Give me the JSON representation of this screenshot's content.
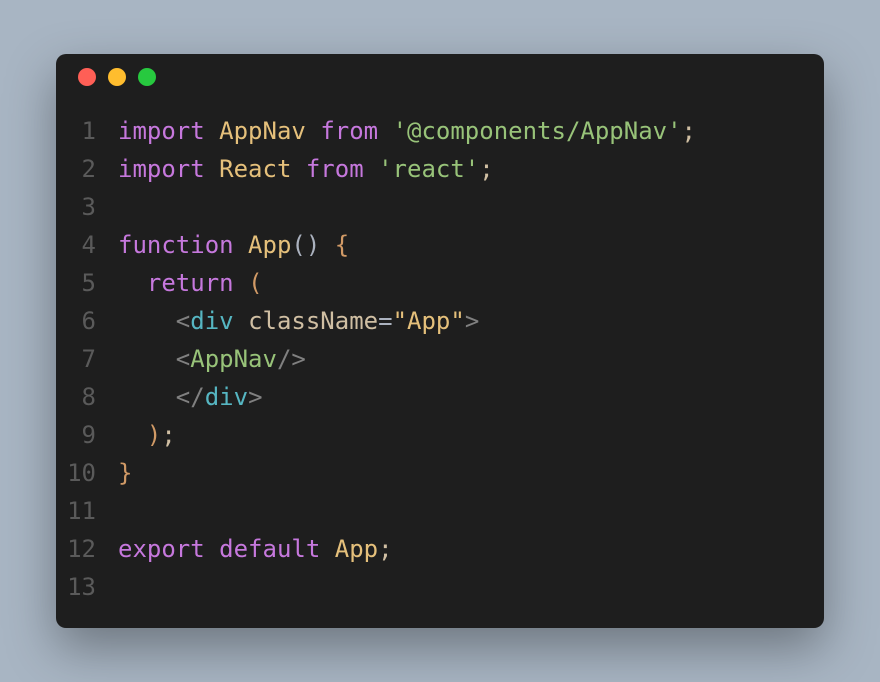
{
  "window": {
    "controls": [
      "close",
      "minimize",
      "zoom"
    ]
  },
  "code": {
    "lines": [
      {
        "n": "1",
        "tokens": [
          {
            "c": "kw",
            "t": "import"
          },
          {
            "c": "plain",
            "t": " "
          },
          {
            "c": "ident",
            "t": "AppNav"
          },
          {
            "c": "plain",
            "t": " "
          },
          {
            "c": "kw",
            "t": "from"
          },
          {
            "c": "plain",
            "t": " "
          },
          {
            "c": "str",
            "t": "'@components/AppNav'"
          },
          {
            "c": "plain",
            "t": ";"
          }
        ]
      },
      {
        "n": "2",
        "tokens": [
          {
            "c": "kw",
            "t": "import"
          },
          {
            "c": "plain",
            "t": " "
          },
          {
            "c": "ident",
            "t": "React"
          },
          {
            "c": "plain",
            "t": " "
          },
          {
            "c": "kw",
            "t": "from"
          },
          {
            "c": "plain",
            "t": " "
          },
          {
            "c": "str",
            "t": "'react'"
          },
          {
            "c": "plain",
            "t": ";"
          }
        ]
      },
      {
        "n": "3",
        "tokens": []
      },
      {
        "n": "4",
        "tokens": [
          {
            "c": "kw",
            "t": "function"
          },
          {
            "c": "plain",
            "t": " "
          },
          {
            "c": "ident",
            "t": "App"
          },
          {
            "c": "punc",
            "t": "()"
          },
          {
            "c": "plain",
            "t": " "
          },
          {
            "c": "brace",
            "t": "{"
          }
        ]
      },
      {
        "n": "5",
        "tokens": [
          {
            "c": "plain",
            "t": "  "
          },
          {
            "c": "kw",
            "t": "return"
          },
          {
            "c": "plain",
            "t": " "
          },
          {
            "c": "brace",
            "t": "("
          }
        ]
      },
      {
        "n": "6",
        "tokens": [
          {
            "c": "plain",
            "t": "    "
          },
          {
            "c": "tag-bracket",
            "t": "<"
          },
          {
            "c": "tag-name",
            "t": "div"
          },
          {
            "c": "plain",
            "t": " "
          },
          {
            "c": "attr-name",
            "t": "className"
          },
          {
            "c": "eq",
            "t": "="
          },
          {
            "c": "attr-val",
            "t": "\"App\""
          },
          {
            "c": "tag-bracket",
            "t": ">"
          }
        ]
      },
      {
        "n": "7",
        "tokens": [
          {
            "c": "plain",
            "t": "    "
          },
          {
            "c": "tag-bracket",
            "t": "<"
          },
          {
            "c": "tag-comp",
            "t": "AppNav"
          },
          {
            "c": "tag-bracket",
            "t": "/>"
          }
        ]
      },
      {
        "n": "8",
        "tokens": [
          {
            "c": "plain",
            "t": "    "
          },
          {
            "c": "tag-bracket",
            "t": "</"
          },
          {
            "c": "tag-name",
            "t": "div"
          },
          {
            "c": "tag-bracket",
            "t": ">"
          }
        ]
      },
      {
        "n": "9",
        "tokens": [
          {
            "c": "plain",
            "t": "  "
          },
          {
            "c": "brace",
            "t": ")"
          },
          {
            "c": "plain",
            "t": ";"
          }
        ]
      },
      {
        "n": "10",
        "tokens": [
          {
            "c": "brace",
            "t": "}"
          }
        ]
      },
      {
        "n": "11",
        "tokens": []
      },
      {
        "n": "12",
        "tokens": [
          {
            "c": "kw",
            "t": "export"
          },
          {
            "c": "plain",
            "t": " "
          },
          {
            "c": "kw",
            "t": "default"
          },
          {
            "c": "plain",
            "t": " "
          },
          {
            "c": "ident",
            "t": "App"
          },
          {
            "c": "plain",
            "t": ";"
          }
        ]
      },
      {
        "n": "13",
        "tokens": []
      }
    ]
  }
}
